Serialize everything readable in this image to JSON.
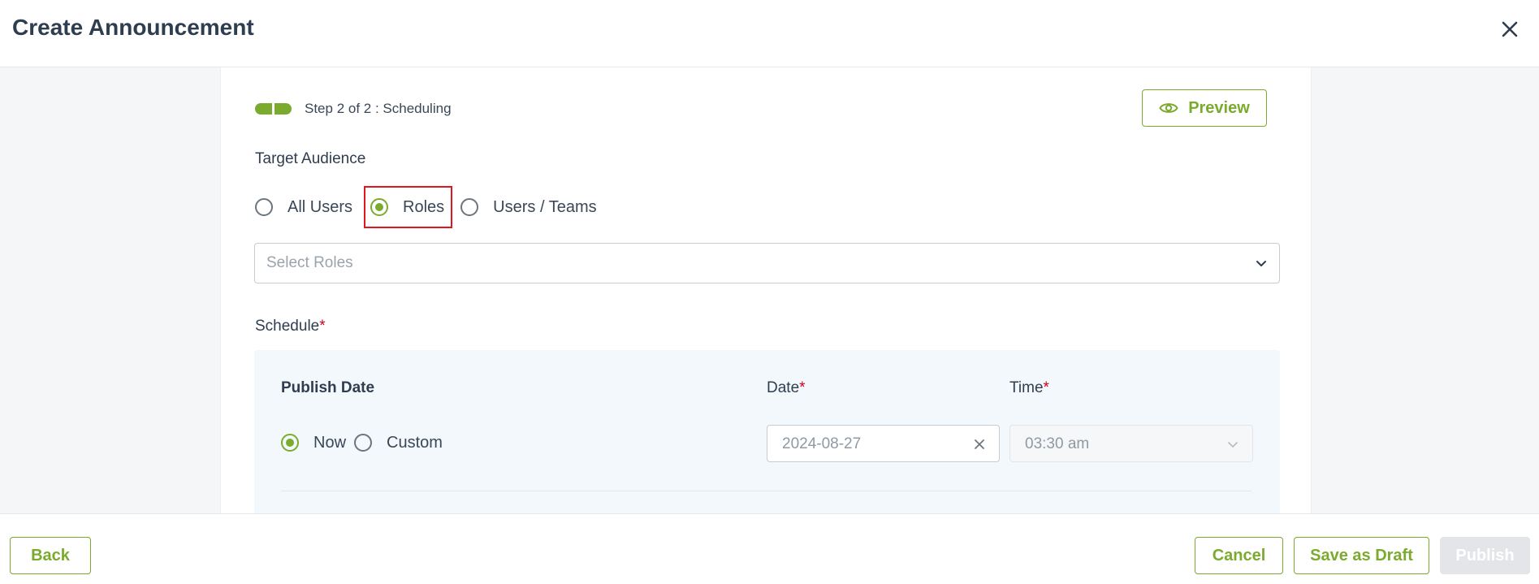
{
  "header": {
    "title": "Create Announcement"
  },
  "stepper": {
    "text": "Step 2 of 2 : Scheduling"
  },
  "preview": {
    "label": "Preview"
  },
  "audience": {
    "title": "Target Audience",
    "options": [
      "All Users",
      "Roles",
      "Users / Teams"
    ],
    "selected": "Roles"
  },
  "roles_select": {
    "placeholder": "Select Roles"
  },
  "schedule": {
    "title": "Schedule",
    "required_mark": "*",
    "publish_date_label": "Publish Date",
    "publish_options": [
      "Now",
      "Custom"
    ],
    "publish_selected": "Now",
    "date_label": "Date",
    "date_value": "2024-08-27",
    "time_label": "Time",
    "time_value": "03:30 am"
  },
  "footer": {
    "back": "Back",
    "cancel": "Cancel",
    "save_draft": "Save as Draft",
    "publish": "Publish"
  },
  "colors": {
    "accent": "#7bab2e",
    "required": "#d0021b",
    "highlight": "#e0161f"
  }
}
